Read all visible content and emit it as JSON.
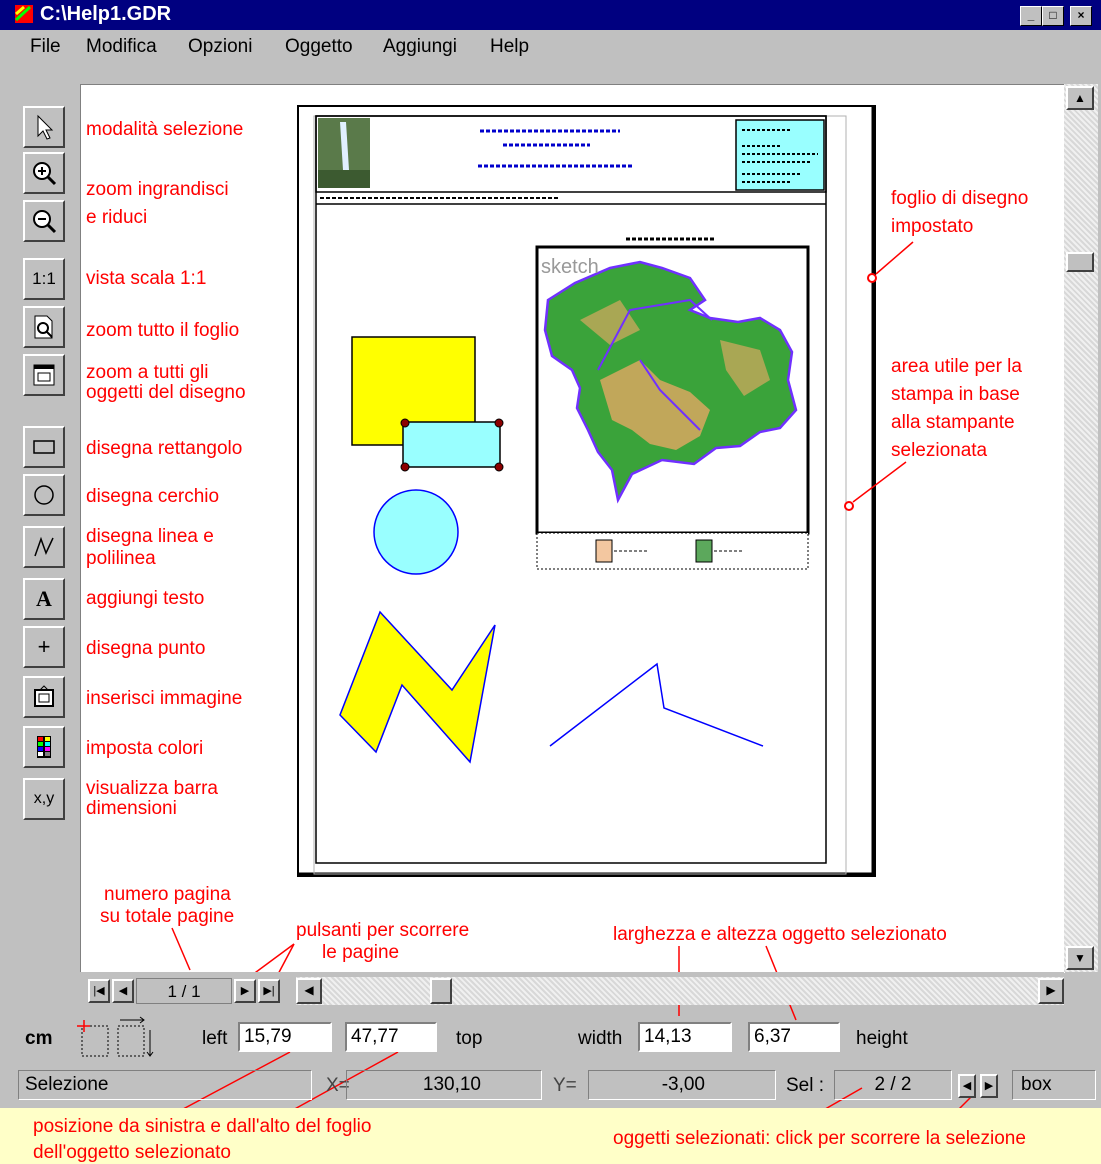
{
  "window": {
    "title": "C:\\Help1.GDR"
  },
  "menu": [
    "File",
    "Modifica",
    "Opzioni",
    "Oggetto",
    "Aggiungi",
    "Help"
  ],
  "toolbar": {
    "zoom_11_label": "1:1",
    "text_tool_label": "A",
    "point_tool_label": "+",
    "xy_label": "x,y"
  },
  "tool_annotations": {
    "select": "modalità selezione",
    "zoom_line1": "zoom ingrandisci",
    "zoom_line2": "e riduci",
    "scale": "vista scala 1:1",
    "zoom_sheet": "zoom tutto il foglio",
    "zoom_objects_line1": "zoom a tutti gli",
    "zoom_objects_line2": "oggetti del disegno",
    "rect": "disegna rettangolo",
    "circle": "disegna cerchio",
    "line_line1": "disegna linea e",
    "line_line2": "polilinea",
    "text": "aggiungi testo",
    "point": "disegna punto",
    "image": "inserisci immagine",
    "colors": "imposta colori",
    "dimbar_line1": "visualizza barra",
    "dimbar_line2": "dimensioni"
  },
  "side_annotations": {
    "sheet_line1": "foglio di disegno",
    "sheet_line2": "impostato",
    "print_line1": "area utile per la",
    "print_line2": "stampa in base",
    "print_line3": "alla stampante",
    "print_line4": "selezionata"
  },
  "page_annotations": {
    "pagenum_line1": "numero pagina",
    "pagenum_line2": "su totale pagine",
    "scroll_line1": "pulsanti per scorrere",
    "scroll_line2": "le pagine",
    "size": "larghezza e altezza oggetto selezionato"
  },
  "sheet": {
    "sketch_label": "sketch"
  },
  "pager": {
    "page": "1 / 1"
  },
  "dimensions": {
    "unit": "cm",
    "left_label": "left",
    "left_value": "15,79",
    "top_value": "47,77",
    "top_label": "top",
    "width_label": "width",
    "width_value": "14,13",
    "height_value": "6,37",
    "height_label": "height"
  },
  "statusbar": {
    "mode": "Selezione",
    "x_label": "X=",
    "x_value": "130,10",
    "y_label": "Y=",
    "y_value": "-3,00",
    "sel_label": "Sel :",
    "sel_value": "2 / 2",
    "shape": "box"
  },
  "bottom_notes": {
    "position_line1": "posizione da sinistra e dall'alto del foglio",
    "position_line2": "dell'oggetto selezionato",
    "selected": "oggetti selezionati: click per scorrere la selezione"
  },
  "colors": {
    "titlebar": "#000080",
    "annotation": "#ff0000",
    "yellow_shape": "#ffff00",
    "cyan_shape": "#99ffff",
    "map_green": "#3aa33a",
    "map_tan": "#d9a860",
    "outline": "#0000ff"
  }
}
